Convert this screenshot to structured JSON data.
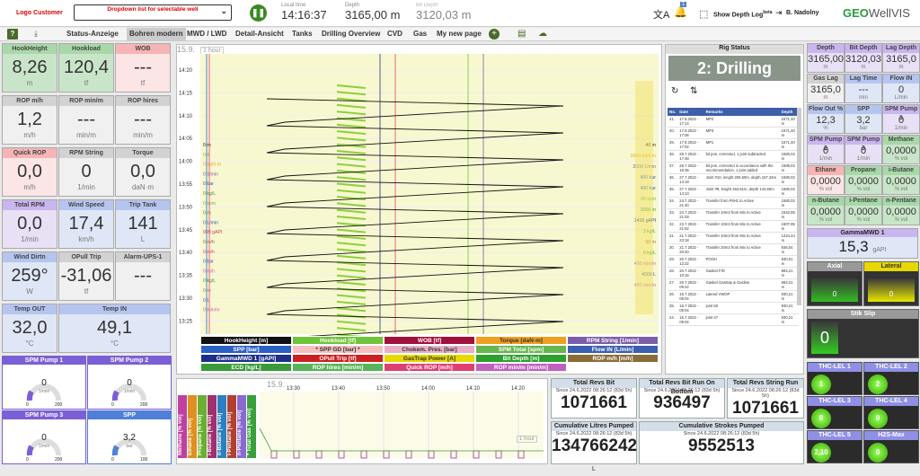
{
  "header": {
    "logo": "Logo Customer",
    "dropdown": "Dropdown list for selectable well",
    "local_time_label": "Local time",
    "local_time": "14:16:37",
    "depth_label": "Depth",
    "depth": "3165,00 m",
    "bit_depth_label": "Bit Depth",
    "bit_depth": "3120,03 m",
    "notif_count": "1",
    "show_depth_log": "Show Depth Log",
    "beta": "beta",
    "user": "B. Nadolny",
    "brand": "GEO",
    "brand2": "WellVIS"
  },
  "nav": {
    "tabs": [
      "Status-Anzeige",
      "Bohren modern",
      "MWD / LWD",
      "Detail-Ansicht",
      "Tanks",
      "Drilling Overview",
      "CVD",
      "Gas",
      "My new page"
    ],
    "active": 1,
    "help": "?"
  },
  "left_tiles": [
    {
      "t": "HookHeight",
      "v": "8,26",
      "u": "m",
      "c": "g"
    },
    {
      "t": "Hookload",
      "v": "120,4",
      "u": "tf",
      "c": "g"
    },
    {
      "t": "WOB",
      "v": "---",
      "u": "tf",
      "c": "p"
    },
    {
      "t": "ROP m/h",
      "v": "1,2",
      "u": "m/h",
      "c": "gr"
    },
    {
      "t": "ROP min/m",
      "v": "---",
      "u": "min/m",
      "c": "gr"
    },
    {
      "t": "ROP hires",
      "v": "---",
      "u": "min/m",
      "c": "gr"
    },
    {
      "t": "Quick ROP",
      "v": "0,0",
      "u": "m/h",
      "c": "p"
    },
    {
      "t": "RPM String",
      "v": "0",
      "u": "1/min",
      "c": "gr"
    },
    {
      "t": "Torque",
      "v": "0,0",
      "u": "daN·m",
      "c": "gr"
    },
    {
      "t": "Total RPM",
      "v": "0,0",
      "u": "1/min",
      "c": "pu"
    },
    {
      "t": "Wind Speed",
      "v": "17,4",
      "u": "km/h",
      "c": "bl"
    },
    {
      "t": "Trip Tank",
      "v": "141",
      "u": "L",
      "c": "bl"
    },
    {
      "t": "Wind Dirtn",
      "v": "259°",
      "u": "W",
      "c": "bl"
    },
    {
      "t": "OPull Trip",
      "v": "-31,06",
      "u": "tf",
      "c": "gr"
    },
    {
      "t": "Alarm-UPS-1",
      "v": "---",
      "u": "",
      "c": "gr"
    },
    {
      "t": "Temp OUT",
      "v": "32,0",
      "u": "°C",
      "c": "bl"
    },
    {
      "t": "Temp IN",
      "v": "49,1",
      "u": "°C",
      "c": "bl"
    }
  ],
  "gauges": [
    {
      "t": "SPM Pump 1",
      "v": "0",
      "u": "1/min",
      "min": "0",
      "max": "200"
    },
    {
      "t": "SPM Pump 2",
      "v": "0",
      "u": "1/min",
      "min": "0",
      "max": "200"
    },
    {
      "t": "SPM Pump 3",
      "v": "0",
      "u": "1/min",
      "min": "0",
      "max": "200"
    },
    {
      "t": "SPP",
      "v": "3,2",
      "u": "bar",
      "min": "0",
      "max": "100"
    }
  ],
  "chart_data": {
    "type": "line",
    "date": "15.9.",
    "interval": "1 hour",
    "y_ticks": [
      "14:20",
      "14:15",
      "14:10",
      "14:05",
      "14:00",
      "13:55",
      "13:50",
      "13:45",
      "13:40",
      "13:35",
      "13:30",
      "13:25"
    ],
    "left_axis_labels": [
      "0 m",
      "0 tf",
      "0 daN·m",
      "0 1/min",
      "0 bar",
      "0 kg/L",
      "0 spm",
      "0 m",
      "0 L/min",
      "999 gAPI",
      "0 m/h",
      "0 m/h",
      "0 bar",
      "0 m/h",
      "0 kg/L",
      "0 m",
      "0 L",
      "0 min/m"
    ],
    "right_axis_labels": [
      "40 m",
      "1000 daN·m",
      "2000 1/min",
      "400 bar",
      "400 bar",
      "40 spm",
      "3000 m",
      "1416 gAPI",
      "3 kg/L",
      "50 m",
      "0 kg/L",
      "400 min/m",
      "4000 L",
      "400 min/m"
    ],
    "legend": [
      [
        "HookHeight [m]",
        "#111"
      ],
      [
        "Hookload [tf]",
        "#6ec43a"
      ],
      [
        "WOB [tf]",
        "#a0113c"
      ],
      [
        "Torque [daN·m]",
        "#f0a020"
      ],
      [
        "RPM String [1/min]",
        "#7b5ea7"
      ],
      [
        "SPP [bar]",
        "#2a5fc4"
      ],
      [
        "* SPP GD [bar] *",
        "#f4c0c0"
      ],
      [
        "Chokem. Pres. [bar]",
        "#e8b0c8"
      ],
      [
        "SPM Total [spm]",
        "#67b64e"
      ],
      [
        "Flow IN [L/min]",
        "#3b5fb0"
      ],
      [
        "GammaMWD 1 [gAPI]",
        "#1c2e8a"
      ],
      [
        "OPull Trip [tf]",
        "#cc2020"
      ],
      [
        "GasTrap Power [A]",
        "#e6d800"
      ],
      [
        "Bit Depth [m]",
        "#2ca02c"
      ],
      [
        "ROP m/h [m/h]",
        "#8b6d3a"
      ],
      [
        "ECD [kg/L]",
        "#3a9a3a"
      ],
      [
        "ROP hires [min/m]",
        "#58b458"
      ],
      [
        "Quick ROP [m/h]",
        "#e04070"
      ],
      [
        "ROP min/m [min/m]",
        "#c060c0"
      ]
    ]
  },
  "rig": {
    "title": "Rig Status",
    "status": "2: Drilling",
    "cols": [
      "No.",
      "Date",
      "Remarks",
      "Depth"
    ],
    "rows": [
      [
        "41.",
        "17.8.2022 - 17:14",
        "MP2",
        "1571,40 m"
      ],
      [
        "40.",
        "17.8.2022 - 17:06",
        "MP3",
        "1571,40 m"
      ],
      [
        "39.",
        "17.8.2022 - 17:02",
        "MP1",
        "1571,40 m"
      ],
      [
        "38.",
        "28.7.2022 - 17:48",
        "bit pos. corrected, 1 joint subtracted",
        "1580,02 m"
      ],
      [
        "37.",
        "28.7.2022 - 16:35",
        "bit pos. corrected in accordance with the recommendation, 1 joint added",
        "1589,02 m"
      ],
      [
        "36.",
        "27.7.2022 - 14:19",
        "Joint #10, lenght 206.50m, depth 157.34m",
        "1580,02 m"
      ],
      [
        "35.",
        "27.7.2022 - 14:13",
        "Joint #9, lenght 153.81m, depth 143.60m",
        "1580,02 m"
      ],
      [
        "34.",
        "24.7.2022 - 21:40",
        "Transfer from PitH1 to Active",
        "1580,02 m"
      ],
      [
        "33.",
        "24.7.2022 - 21:03",
        "Transfer 10m3 from Mix to Active",
        "1542,85 m"
      ],
      [
        "32.",
        "23.7.2022 - 21:52",
        "Transfer 10m3 from Mix to Active",
        "1507,95 m"
      ],
      [
        "31.",
        "21.7.2022 - 23:18",
        "Transfer 10m3 from Mix to Active",
        "1224,44 m"
      ],
      [
        "30.",
        "21.7.2022 - 20:40",
        "Transfer 20m3 from Mix to Active",
        "936,04 m"
      ],
      [
        "29.",
        "20.7.2022 - 12:22",
        "POOH",
        "930,01 m"
      ],
      [
        "28.",
        "20.7.2022 - 10:16",
        "Gasket F/D",
        "894,21 m"
      ],
      [
        "27.",
        "20.7.2022 - 09:42",
        "Gasket Gastrap & Gasline",
        "894,21 m"
      ],
      [
        "26.",
        "16.7.2022 - 05:04",
        "Lateral VWOP",
        "930,21 m"
      ],
      [
        "25.",
        "16.7.2022 - 05:04",
        "joint 50",
        "930,21 m"
      ],
      [
        "24.",
        "15.7.2022 - 05:04",
        "joint 47",
        "930,21 m"
      ]
    ]
  },
  "right_tiles": [
    {
      "t": "Depth",
      "v": "3165,00",
      "u": "m",
      "c": "pu"
    },
    {
      "t": "Bit Depth",
      "v": "3120,03",
      "u": "m",
      "c": "pu"
    },
    {
      "t": "Lag Depth",
      "v": "3165,0",
      "u": "m",
      "c": "pu"
    },
    {
      "t": "Gas Lag",
      "v": "3165,0",
      "u": "m",
      "c": "gr"
    },
    {
      "t": "Lag Time",
      "v": "---",
      "u": "min",
      "c": "bl"
    },
    {
      "t": "Flow IN",
      "v": "0",
      "u": "L/min",
      "c": "bl"
    },
    {
      "t": "Flow Out %",
      "v": "12,3",
      "u": "%",
      "c": "bl"
    },
    {
      "t": "SPP",
      "v": "3,2",
      "u": "bar",
      "c": "bl"
    },
    {
      "t": "SPM Pump 1",
      "v": "0",
      "u": "1/min",
      "c": "pu"
    },
    {
      "t": "SPM Pump 2",
      "v": "0",
      "u": "1/min",
      "c": "pu"
    },
    {
      "t": "SPM Pump 3",
      "v": "0",
      "u": "1/min",
      "c": "pu"
    },
    {
      "t": "Methane",
      "v": "0,0000",
      "u": "% vol",
      "c": "g"
    },
    {
      "t": "Ethane",
      "v": "0,0000",
      "u": "% vol",
      "c": "p"
    },
    {
      "t": "Propane",
      "v": "0,0000",
      "u": "% vol",
      "c": "g"
    },
    {
      "t": "i-Butane",
      "v": "0,0000",
      "u": "% vol",
      "c": "g"
    },
    {
      "t": "n-Butane",
      "v": "0,0000",
      "u": "% vol",
      "c": "g"
    },
    {
      "t": "i-Pentane",
      "v": "0,0000",
      "u": "% vol",
      "c": "g"
    },
    {
      "t": "n-Pentane",
      "v": "0,0000",
      "u": "% vol",
      "c": "g"
    }
  ],
  "gamma": {
    "t": "GammaMWD 1",
    "v": "15,3",
    "u": "gAPI"
  },
  "axial": {
    "t": "Axial",
    "v": "0"
  },
  "lateral": {
    "t": "Lateral",
    "v": "0"
  },
  "stickslip": {
    "t": "Stik Slip",
    "v": "0"
  },
  "thc": [
    {
      "t": "THC-LEL 1",
      "v": "1"
    },
    {
      "t": "THC-LEL 2",
      "v": "2"
    },
    {
      "t": "THC-LEL 3",
      "v": "0"
    },
    {
      "t": "THC-LEL 4",
      "v": "0"
    },
    {
      "t": "THC-LEL 5",
      "v": "2,10"
    },
    {
      "t": "H2S-Max",
      "v": "0"
    }
  ],
  "gas_chart": {
    "date": "15.9.",
    "interval": "1 hour",
    "x_ticks": [
      "13:30",
      "13:40",
      "13:50",
      "14:00",
      "14:10",
      "14:20"
    ],
    "tabs": [
      [
        "Methane [% vol]",
        "#c040a0"
      ],
      [
        "Ethane [% vol]",
        "#e09020"
      ],
      [
        "Propane [% vol]",
        "#6ab030"
      ],
      [
        "i-Butane [% vol]",
        "#a03070"
      ],
      [
        "n-Butane [% vol]",
        "#2a80c0"
      ],
      [
        "i-Pentane [% vol]",
        "#b04030"
      ],
      [
        "n-Pentane [% vol]",
        "#8a6ad0"
      ],
      [
        "* Total Gas [% vol]",
        "#3aa03a"
      ]
    ]
  },
  "counters": [
    {
      "t": "Total Revs Bit",
      "s": "Since 24.6.2022 08:26:12 (83d 5h)",
      "v": "1071661"
    },
    {
      "t": "Total Revs Bit Run On Bottom",
      "s": "Since 24.6.2022 08:26:12 (83d 5h)",
      "v": "936497"
    },
    {
      "t": "Total Revs String Run",
      "s": "Since 24.6.2022 08:26:12 (83d 5h)",
      "v": "1071661"
    },
    {
      "t": "Cumulative Litres Pumped",
      "s": "Since 24.6.2022 08:26:12 (83d 5h)",
      "v": "134766242",
      "u": "L"
    },
    {
      "t": "Cumulative Strokes Pumped",
      "s": "Since 24.6.2022 08:26:12 (83d 5h)",
      "v": "9552513"
    }
  ]
}
